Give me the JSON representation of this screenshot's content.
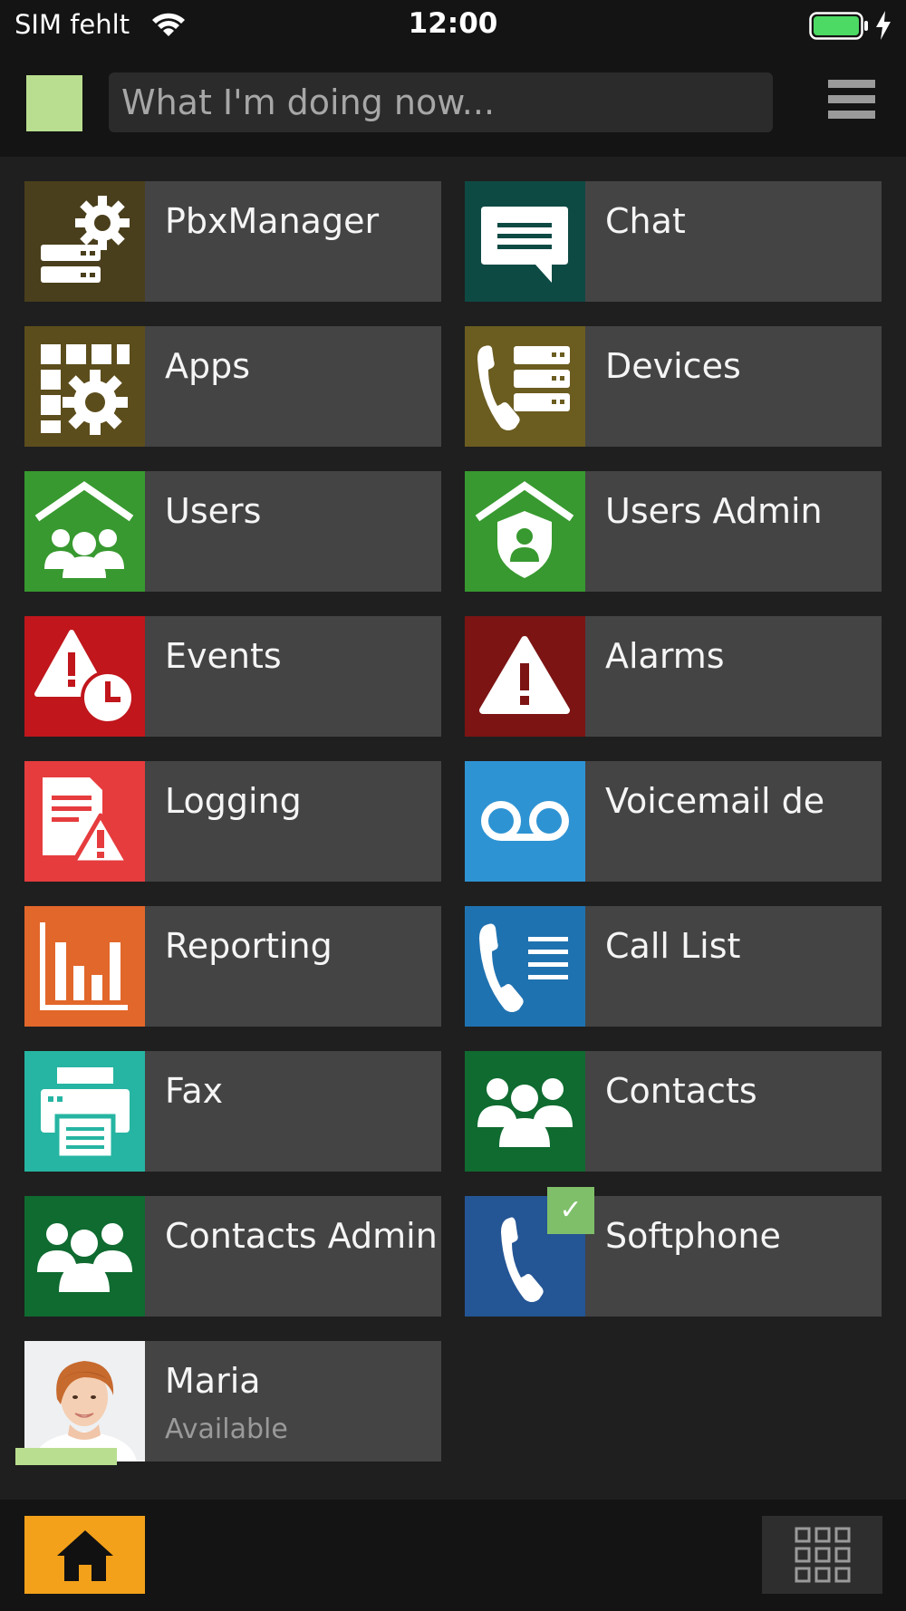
{
  "status_bar": {
    "carrier": "SIM fehlt",
    "time": "12:00",
    "battery_color": "#4cd964"
  },
  "header": {
    "status_placeholder": "What I'm doing now...",
    "avatar_color": "#b9de8f",
    "menu_icon": "hamburger-menu-icon"
  },
  "tiles": [
    {
      "label": "PbxManager",
      "icon": "pbx-manager-icon",
      "color": "#4a3f1c"
    },
    {
      "label": "Chat",
      "icon": "chat-bubble-icon",
      "color": "#0e4a44"
    },
    {
      "label": "Apps",
      "icon": "apps-gear-icon",
      "color": "#5c4d1c"
    },
    {
      "label": "Devices",
      "icon": "phone-devices-icon",
      "color": "#6b5c20"
    },
    {
      "label": "Users",
      "icon": "users-house-icon",
      "color": "#37992f"
    },
    {
      "label": "Users Admin",
      "icon": "users-admin-shield-icon",
      "color": "#37992f"
    },
    {
      "label": "Events",
      "icon": "events-warning-clock-icon",
      "color": "#c0161c"
    },
    {
      "label": "Alarms",
      "icon": "alarm-warning-icon",
      "color": "#7c1414"
    },
    {
      "label": "Logging",
      "icon": "logging-document-icon",
      "color": "#e63c3e"
    },
    {
      "label": "Voicemail de",
      "icon": "voicemail-icon",
      "color": "#2e93d3"
    },
    {
      "label": "Reporting",
      "icon": "bar-chart-icon",
      "color": "#e2672a"
    },
    {
      "label": "Call List",
      "icon": "call-list-icon",
      "color": "#1f72b0"
    },
    {
      "label": "Fax",
      "icon": "fax-printer-icon",
      "color": "#26b5a2"
    },
    {
      "label": "Contacts",
      "icon": "contacts-group-icon",
      "color": "#0f6b30"
    },
    {
      "label": "Contacts Admin",
      "icon": "contacts-admin-group-icon",
      "color": "#0f6b30"
    },
    {
      "label": "Softphone",
      "icon": "softphone-handset-icon",
      "color": "#245595",
      "badge": "✓"
    }
  ],
  "user_tile": {
    "name": "Maria",
    "presence": "Available",
    "presence_color": "#b9de8f"
  },
  "bottom_bar": {
    "home_icon": "home-icon",
    "home_color": "#f3a11a",
    "grid_icon": "app-grid-icon"
  }
}
